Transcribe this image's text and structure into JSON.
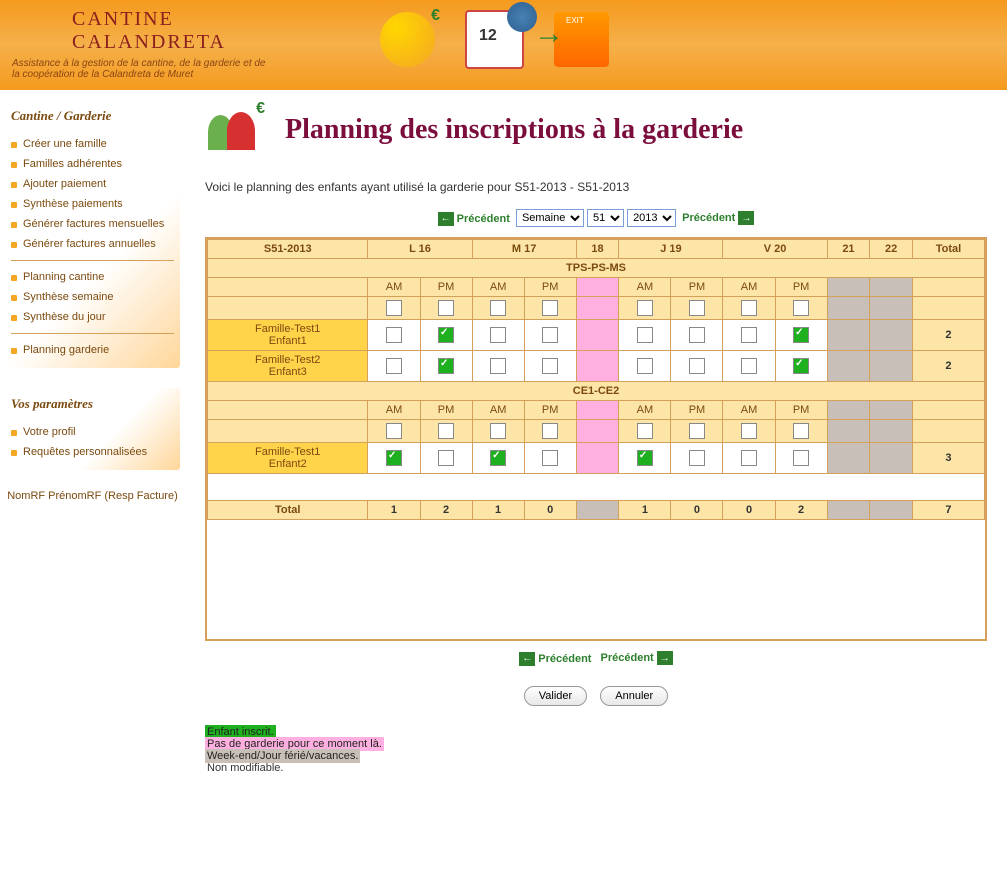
{
  "header": {
    "title1": "CANTINE",
    "title2": "CALANDRETA",
    "subtitle": "Assistance à la gestion de la cantine, de la garderie et de la coopération de la Calandreta de Muret"
  },
  "sidebar": {
    "section1_title": "Cantine / Garderie",
    "group1": [
      "Créer une famille",
      "Familles adhérentes",
      "Ajouter paiement",
      "Synthèse paiements",
      "Générer factures mensuelles",
      "Générer factures annuelles"
    ],
    "group2": [
      "Planning cantine",
      "Synthèse semaine",
      "Synthèse du jour"
    ],
    "group3": [
      "Planning garderie"
    ],
    "section2_title": "Vos paramètres",
    "group4": [
      "Votre profil",
      "Requêtes personnalisées"
    ],
    "user": "NomRF PrénomRF (Resp Facture)"
  },
  "page": {
    "title": "Planning des inscriptions à la garderie",
    "intro": "Voici le planning des enfants ayant utilisé la garderie pour S51-2013 - S51-2013"
  },
  "nav": {
    "prev": "Précédent",
    "next": "Précédent",
    "period_opt": "Semaine",
    "week_opt": "51",
    "year_opt": "2013"
  },
  "table": {
    "week": "S51-2013",
    "days": [
      "L 16",
      "M 17",
      "18",
      "J 19",
      "V 20",
      "21",
      "22"
    ],
    "total": "Total",
    "am": "AM",
    "pm": "PM",
    "group1": "TPS-PS-MS",
    "group2": "CE1-CE2",
    "rows1": [
      {
        "family": "Famille-Test1",
        "child": "Enfant1",
        "slots": [
          [
            0,
            1
          ],
          [
            0,
            0
          ],
          [
            0,
            0
          ],
          [
            0,
            1
          ]
        ],
        "total": "2"
      },
      {
        "family": "Famille-Test2",
        "child": "Enfant3",
        "slots": [
          [
            0,
            1
          ],
          [
            0,
            0
          ],
          [
            0,
            0
          ],
          [
            0,
            1
          ]
        ],
        "total": "2"
      }
    ],
    "rows2": [
      {
        "family": "Famille-Test1",
        "child": "Enfant2",
        "slots": [
          [
            1,
            0
          ],
          [
            1,
            0
          ],
          [
            1,
            0
          ],
          [
            0,
            0
          ]
        ],
        "total": "3"
      }
    ],
    "totals": [
      "1",
      "2",
      "1",
      "0",
      "",
      "1",
      "0",
      "0",
      "2",
      "",
      "7"
    ],
    "total_label": "Total"
  },
  "actions": {
    "validate": "Valider",
    "cancel": "Annuler"
  },
  "legend": {
    "l1": "Enfant inscrit.",
    "l2": "Pas de garderie pour ce moment là.",
    "l3": "Week-end/Jour férié/vacances.",
    "l4": "Non modifiable."
  }
}
